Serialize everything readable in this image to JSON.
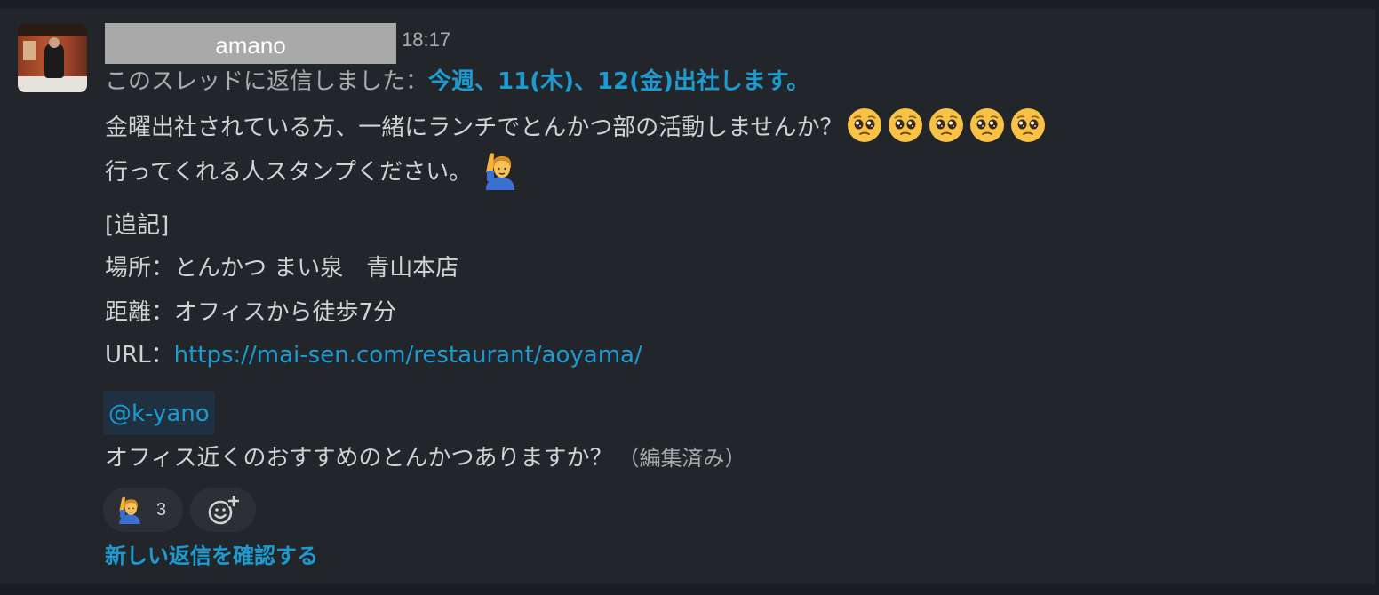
{
  "message": {
    "author": "amano",
    "timestamp": "18:17",
    "thread_prefix": "このスレッドに返信しました：",
    "thread_link": "今週、11(木)、12(金)出社します。",
    "lines": [
      "金曜出社されている方、一緒にランチでとんかつ部の活動しませんか？",
      "行ってくれる人スタンプください。",
      "[追記]",
      "場所：とんかつ まい泉　青山本店",
      "距離：オフィスから徒歩7分"
    ],
    "url_label": "URL：",
    "url": "https://mai-sen.com/restaurant/aoyama/",
    "mention": "@k-yano",
    "question": "オフィス近くのおすすめのとんかつありますか？",
    "edited": "（編集済み）"
  },
  "emoji": {
    "pleading_face": "pleading-face-icon",
    "pleading_count": 5,
    "raising_hand": "person-raising-hand-icon"
  },
  "reactions": [
    {
      "emoji": "person-raising-hand-icon",
      "count": "3"
    }
  ],
  "add_reaction_icon": "add-reaction-icon",
  "new_replies_label": "新しい返信を確認する",
  "colors": {
    "background": "#1a1d21",
    "panel": "#222529",
    "text": "#d1d2d3",
    "muted": "#ababad",
    "link": "#1d9bd1",
    "mention_bg": "#1f3140",
    "reaction_bg": "#2c2f33"
  }
}
